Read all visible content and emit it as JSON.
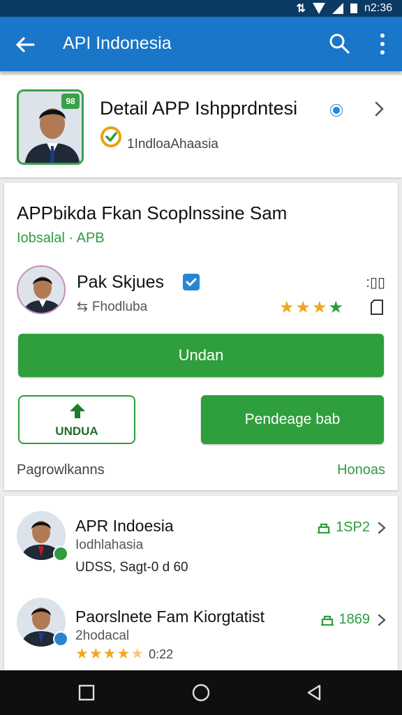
{
  "status_bar": {
    "time": "n2:36"
  },
  "app_bar": {
    "title": "API Indonesia",
    "icons": [
      "back-arrow-icon",
      "search-icon",
      "more-vert-icon"
    ]
  },
  "header": {
    "app_title": "Detail APP Ishpprdntesi",
    "publisher": "1IndloaAhaasia",
    "icon_badge": "98"
  },
  "detail": {
    "title": "APPbikda Fkan Scoplnssine Sam",
    "subtitle": "Iobsalal · APB",
    "developer_name": "Pak Skjues",
    "developer_sub": "Fhodluba",
    "meta_label": ":▯▯",
    "rating_stars": 4,
    "primary_button": "Undan",
    "outline_button": "UNDUA",
    "secondary_button": "Pendeage bab",
    "footer_left": "Pagrowlkanns",
    "footer_right": "Honoas"
  },
  "list": [
    {
      "title": "APR Indoesia",
      "sub": "Iodhlahasia",
      "extra": "UDSS, Sagt-0 d 60",
      "meta": "1SP2",
      "badge_color": "#2e9c3e"
    },
    {
      "title": "Paorslnete Fam Kiorgtatist",
      "sub": "2hodacal",
      "rating_text": "0:22",
      "stars": 4.5,
      "meta": "1869",
      "badge_color": "#2a85d0"
    }
  ],
  "colors": {
    "primary_blue": "#1976c8",
    "accent_green": "#2f9e3c",
    "star": "#f2a61b",
    "status_bar": "#0b3a63"
  },
  "nav_bar": {
    "icons": [
      "recents-square-icon",
      "home-circle-icon",
      "back-triangle-icon"
    ]
  }
}
